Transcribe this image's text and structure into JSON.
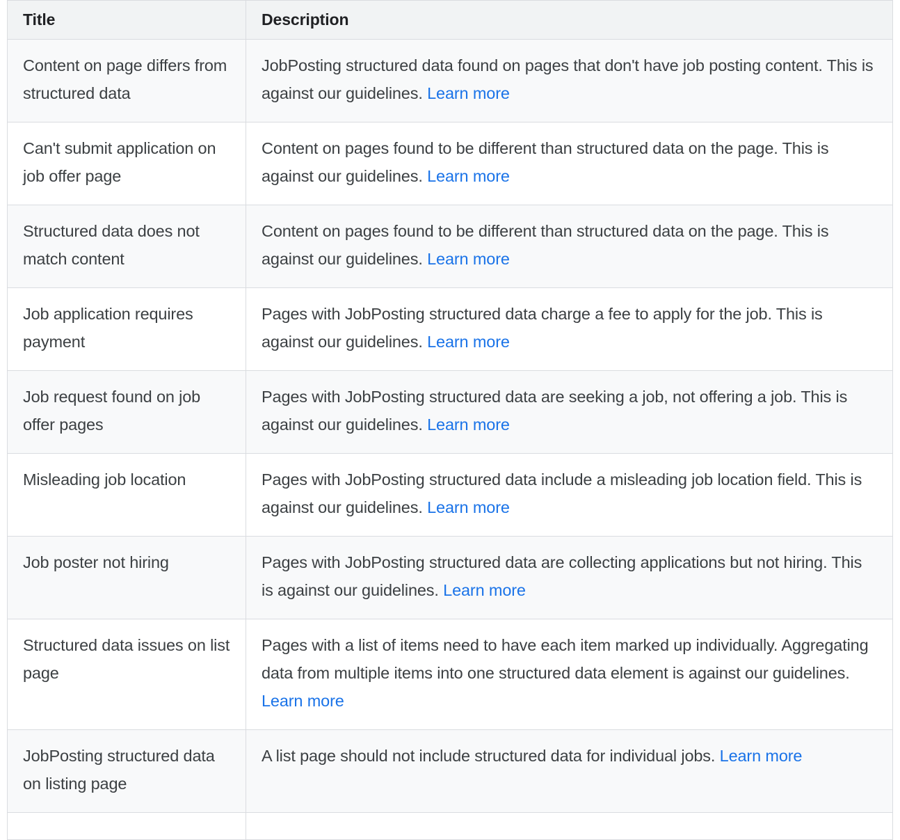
{
  "table": {
    "columns": [
      {
        "key": "title",
        "label": "Title"
      },
      {
        "key": "description",
        "label": "Description"
      }
    ],
    "link_label": "Learn more",
    "link_color": "#1a73e8",
    "header_background": "#f1f3f4",
    "shaded_row_background": "#f8f9fa",
    "plain_row_background": "#ffffff",
    "border_color": "#dadce0",
    "text_color": "#3c4043",
    "header_text_color": "#202124",
    "rows": [
      {
        "title": "Content on page differs from structured data",
        "description": "JobPosting structured data found on pages that don't have job posting content. This is against our guidelines.",
        "link": "Learn more"
      },
      {
        "title": "Can't submit application on job offer page",
        "description": "Content on pages found to be different than structured data on the page. This is against our guidelines.",
        "link": "Learn more"
      },
      {
        "title": "Structured data does not match content",
        "description": "Content on pages found to be different than structured data on the page. This is against our guidelines.",
        "link": "Learn more"
      },
      {
        "title": "Job application requires payment",
        "description": "Pages with JobPosting structured data charge a fee to apply for the job. This is against our guidelines.",
        "link": "Learn more"
      },
      {
        "title": "Job request found on job offer pages",
        "description": "Pages with JobPosting structured data are seeking a job, not offering a job. This is against our guidelines.",
        "link": "Learn more"
      },
      {
        "title": "Misleading job location",
        "description": "Pages with JobPosting structured data include a misleading job location field. This is against our guidelines.",
        "link": "Learn more"
      },
      {
        "title": "Job poster not hiring",
        "description": "Pages with JobPosting structured data are collecting applications but not hiring. This is against our guidelines.",
        "link": "Learn more"
      },
      {
        "title": "Structured data issues on list page",
        "description": "Pages with a list of items need to have each item marked up individually. Aggregating data from multiple items into one structured data element is against our guidelines.",
        "link": "Learn more"
      },
      {
        "title": "JobPosting structured data on listing page",
        "description": "A list page should not include structured data for individual jobs.",
        "link": "Learn more"
      },
      {
        "title": "",
        "description": "",
        "link": ""
      }
    ]
  }
}
